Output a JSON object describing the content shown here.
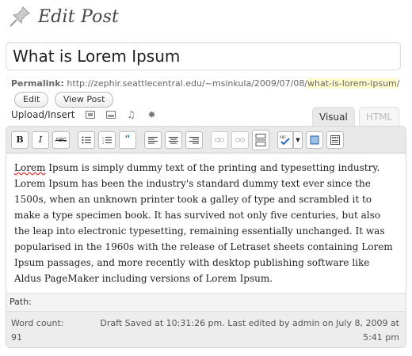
{
  "page": {
    "title": "Edit Post",
    "pin_icon": "pushpin-icon"
  },
  "post": {
    "title_value": "What is Lorem Ipsum",
    "permalink_label": "Permalink:",
    "permalink_base": "http://zephir.seattlecentral.edu/~msinkula/2009/07/08/",
    "permalink_slug": "what-is-lorem-ipsum",
    "permalink_tail": "/",
    "edit_label": "Edit",
    "view_label": "View Post"
  },
  "upload": {
    "label": "Upload/Insert",
    "icons": [
      "image-icon",
      "video-icon",
      "audio-icon",
      "media-icon"
    ]
  },
  "tabs": {
    "visual": "Visual",
    "html": "HTML"
  },
  "toolbar": {
    "buttons": [
      {
        "name": "bold-icon",
        "glyph": "B"
      },
      {
        "name": "italic-icon",
        "glyph": "I"
      },
      {
        "name": "strikethrough-icon",
        "glyph": "ABC"
      },
      {
        "name": "bullet-list-icon",
        "glyph": "≡"
      },
      {
        "name": "numbered-list-icon",
        "glyph": "≡"
      },
      {
        "name": "blockquote-icon",
        "glyph": "“"
      },
      {
        "name": "align-left-icon",
        "glyph": "≡"
      },
      {
        "name": "align-center-icon",
        "glyph": "≡"
      },
      {
        "name": "align-right-icon",
        "glyph": "≡"
      },
      {
        "name": "link-icon",
        "glyph": "∞"
      },
      {
        "name": "unlink-icon",
        "glyph": "∞"
      },
      {
        "name": "more-tag-icon",
        "glyph": "▭"
      },
      {
        "name": "spellcheck-icon",
        "glyph": "ABC"
      },
      {
        "name": "fullscreen-icon",
        "glyph": "▢"
      },
      {
        "name": "kitchen-sink-icon",
        "glyph": "▦"
      }
    ]
  },
  "content": {
    "first_word": "Lorem",
    "body": " Ipsum is simply dummy text of the printing and typesetting industry. Lorem Ipsum has been the industry's standard dummy text ever since the 1500s, when an unknown printer took a galley of type and scrambled it to make a type specimen book. It has survived not only five centuries, but also the leap into electronic typesetting, remaining essentially unchanged. It was popularised in the 1960s with the release of Letraset sheets containing Lorem Ipsum passages, and more recently with desktop publishing software like Aldus PageMaker including versions of Lorem Ipsum."
  },
  "status": {
    "path_label": "Path:",
    "word_count": "Word count: 91",
    "draft_saved": "Draft Saved at 10:31:26 pm. Last edited by admin on July 8, 2009 at 5:41 pm"
  }
}
